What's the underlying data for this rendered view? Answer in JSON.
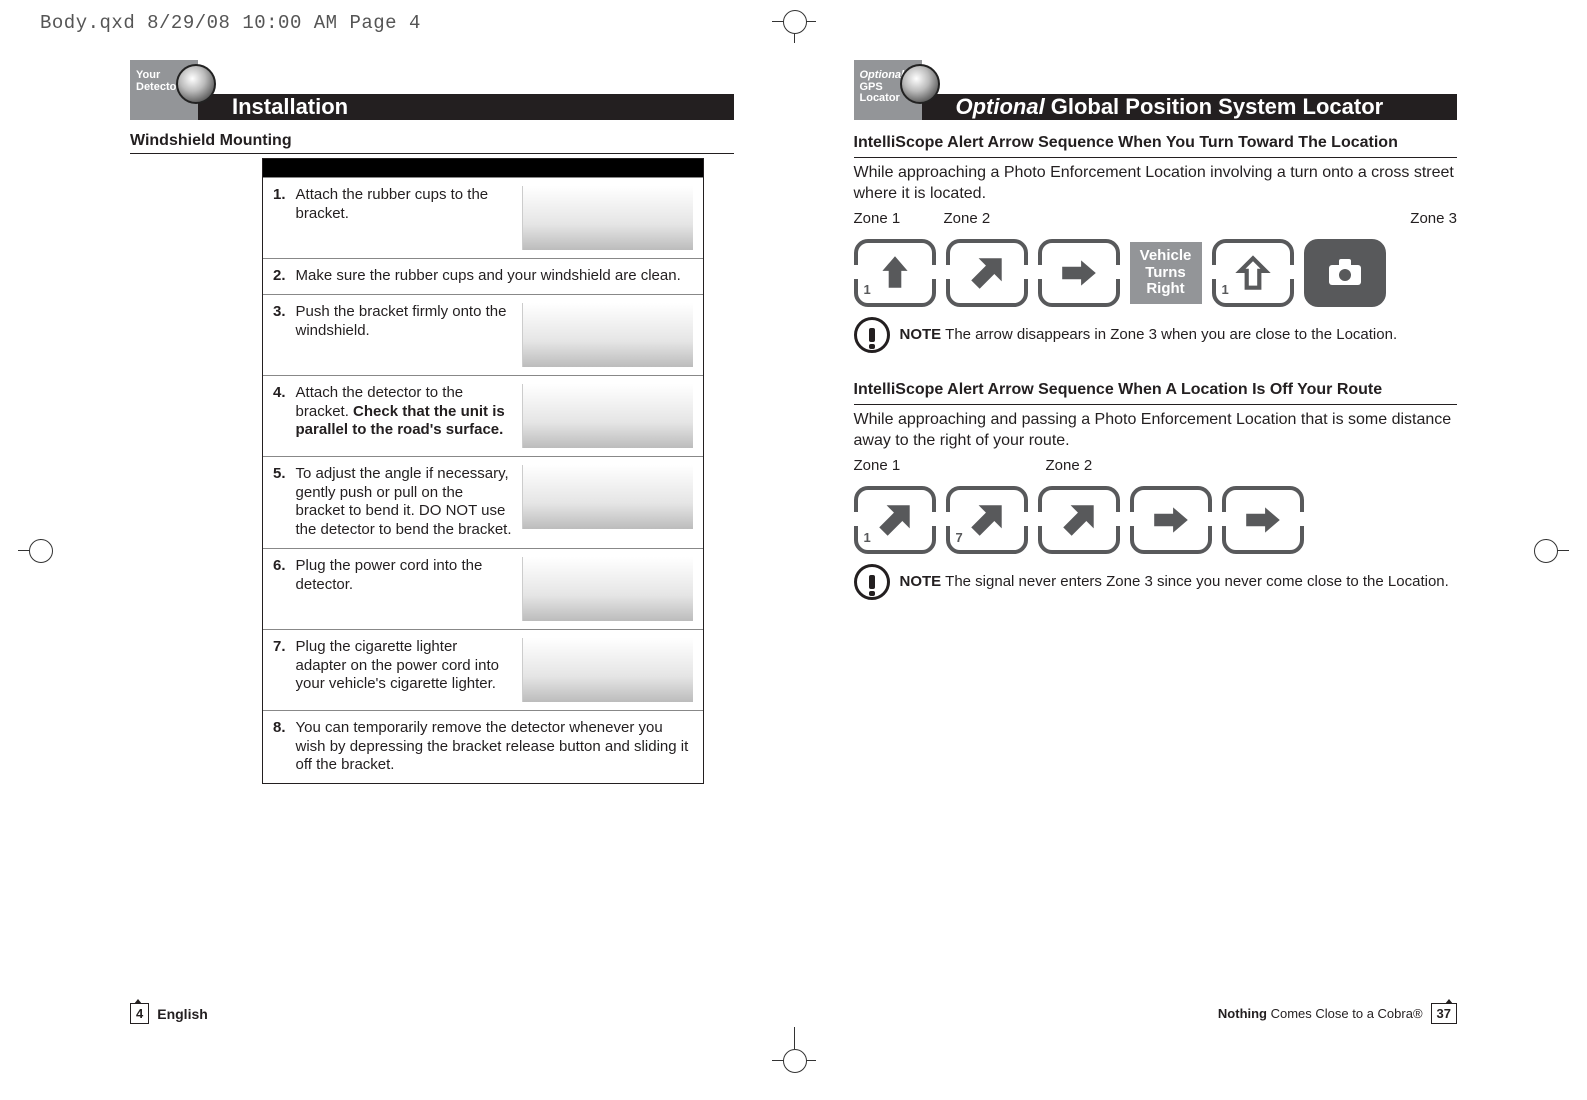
{
  "meta": {
    "running_head": "Body.qxd  8/29/08  10:00 AM  Page 4"
  },
  "left": {
    "tab_line1": "Your Detector",
    "title": "Installation",
    "subhead": "Windshield Mounting",
    "steps": [
      {
        "num": "1.",
        "text": "Attach the rubber cups to the bracket.",
        "img": true
      },
      {
        "num": "2.",
        "text": "Make sure the rubber cups and your windshield are clean.",
        "img": false
      },
      {
        "num": "3.",
        "text": "Push the bracket firmly onto the windshield.",
        "img": true
      },
      {
        "num": "4.",
        "text_pre": "Attach the detector to the bracket. ",
        "text_bold": "Check that the unit is parallel to the road's surface.",
        "img": true
      },
      {
        "num": "5.",
        "text": "To adjust the angle if necessary, gently push or pull on the bracket to bend it. DO NOT use the detector to bend the bracket.",
        "img": true
      },
      {
        "num": "6.",
        "text": "Plug the power cord into the detector.",
        "img": true
      },
      {
        "num": "7.",
        "text": "Plug the cigarette lighter adapter on the power cord into your vehicle's cigarette lighter.",
        "img": true
      },
      {
        "num": "8.",
        "text": "You can temporarily remove the detector whenever you wish by depressing the bracket release button and sliding it off the bracket.",
        "img": false
      }
    ]
  },
  "right": {
    "tab_line1": "Optional",
    "tab_line2": "GPS Locator",
    "title_italic": "Optional",
    "title_rest": "Global Position System Locator",
    "section1": {
      "heading": "IntelliScope Alert Arrow Sequence When You Turn Toward The Location",
      "body": "While approaching a Photo Enforcement Location involving a turn onto a cross street where it is located.",
      "zones": {
        "z1": "Zone 1",
        "z2": "Zone 2",
        "z3": "Zone 3"
      },
      "turn_line1": "Vehicle",
      "turn_line2": "Turns",
      "turn_line3": "Right",
      "note_label": "NOTE",
      "note_text": "The arrow disappears in Zone 3 when you are close to the Location."
    },
    "section2": {
      "heading": "IntelliScope Alert Arrow Sequence When A Location Is Off Your Route",
      "body": "While approaching and passing a Photo Enforcement Location that is some distance away to the right of your route.",
      "zones": {
        "z1": "Zone 1",
        "z2": "Zone 2"
      },
      "note_label": "NOTE",
      "note_text": "The signal never enters Zone 3 since you never come close to the Location."
    }
  },
  "footer": {
    "page_left": "4",
    "language": "English",
    "tagline_bold": "Nothing",
    "tagline_rest": " Comes Close to a Cobra®",
    "page_right": "37"
  }
}
